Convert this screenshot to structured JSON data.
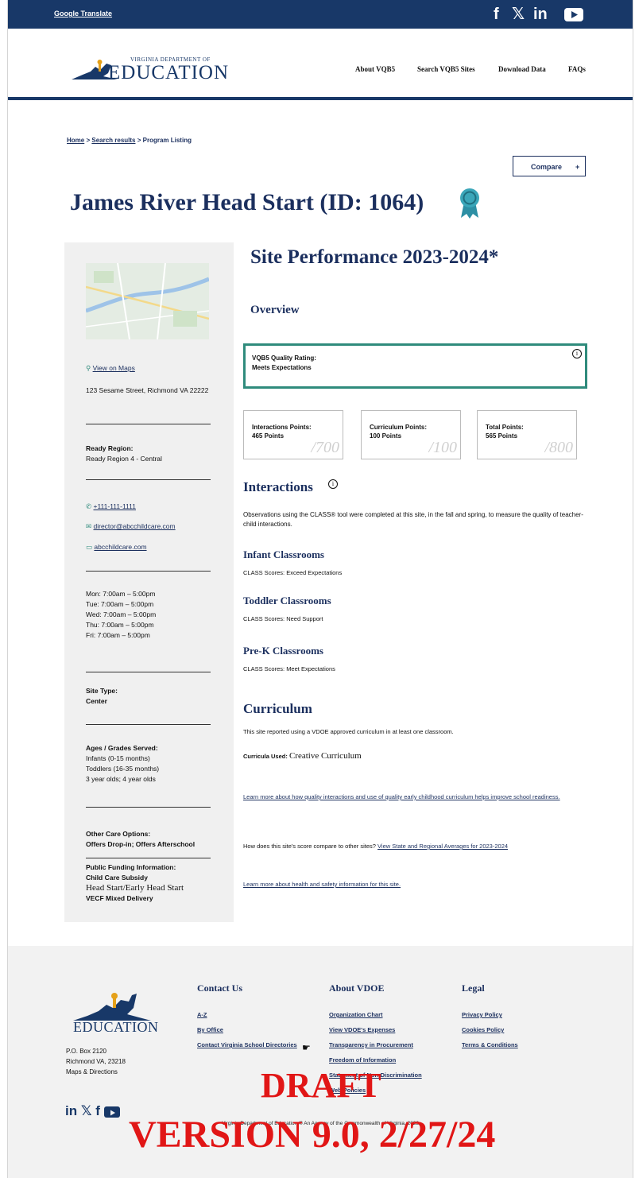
{
  "topbar": {
    "google_translate": "Google Translate",
    "social": [
      "f",
      "𝕏",
      "in",
      "▶"
    ]
  },
  "header": {
    "logo_text": "EDUCATION",
    "logo_subtext": "VIRGINIA DEPARTMENT OF",
    "nav": [
      "About VQB5",
      "Search VQB5 Sites",
      "Download Data",
      "FAQs"
    ]
  },
  "breadcrumb": {
    "home": "Home",
    "sep1": " > ",
    "search": "Search results",
    "sep2": " > ",
    "current": "Program Listing"
  },
  "compare": {
    "label": "Compare",
    "icon": "+"
  },
  "title": "James River Head Start (ID: 1064)",
  "sidebar": {
    "map_link": "View on Maps",
    "address": "123 Sesame Street, Richmond VA 22222",
    "region_label": "Ready Region:",
    "region_value": "Ready Region 4 - Central",
    "phone": "+111-111-1111",
    "email": "director@abcchildcare.com",
    "website": "abcchildcare.com",
    "hours": [
      "Mon: 7:00am – 5:00pm",
      "Tue: 7:00am – 5:00pm",
      "Wed: 7:00am – 5:00pm",
      "Thu: 7:00am – 5:00pm",
      "Fri: 7:00am – 5:00pm"
    ],
    "site_type_label": "Site Type:",
    "site_type_value": "Center",
    "ages_label": "Ages / Grades Served:",
    "ages_values": [
      "Infants (0-15 months)",
      "Toddlers (16-35 months)",
      "3 year olds; 4 year olds"
    ],
    "other_label": "Other Care Options:",
    "other_value": "Offers Drop-in; Offers Afterschool",
    "funding_label": "Public Funding Information:",
    "funding_values": [
      "Child Care Subsidy",
      "Head Start/Early Head Start",
      "VECF Mixed Delivery"
    ]
  },
  "main": {
    "heading": "Site Performance 2023-2024*",
    "overview": "Overview",
    "quality_label": "VQB5 Quality Rating:",
    "quality_value": "Meets Expectations",
    "points": [
      {
        "label": "Interactions Points:",
        "value": "465 Points",
        "max": "/700"
      },
      {
        "label": "Curriculum Points:",
        "value": "100 Points",
        "max": "/100"
      },
      {
        "label": "Total Points:",
        "value": "565 Points",
        "max": "/800"
      }
    ],
    "interactions_heading": "Interactions",
    "interactions_text": "Observations using the CLASS® tool were completed at this site, in the fall and spring, to measure the quality of teacher-child interactions.",
    "classrooms": [
      {
        "heading": "Infant Classrooms",
        "text": "CLASS Scores: Exceed Expectations"
      },
      {
        "heading": "Toddler Classrooms",
        "text": "CLASS Scores: Need Support"
      },
      {
        "heading": "Pre-K Classrooms",
        "text": "CLASS Scores: Meet Expectations"
      }
    ],
    "curriculum_heading": "Curriculum",
    "curriculum_text": "This site reported using a VDOE approved curriculum in at least one classroom.",
    "curricula_label": "Curricula Used:",
    "curricula_value": "Creative Curriculum",
    "learn_more_1": "Learn more about how quality interactions and use of quality early childhood curriculum helps improve school readiness.",
    "compare_question": "How does this site's score compare to other sites?",
    "compare_link": "View State and Regional Averages for 2023-2024",
    "learn_more_2": "Learn more about health and safety information for this site."
  },
  "footer": {
    "logo_text": "EDUCATION",
    "address": [
      "P.O. Box 2120",
      "Richmond VA, 23218",
      "Maps & Directions"
    ],
    "contact_heading": "Contact Us",
    "contact_links": [
      "A-Z",
      "By Office",
      "Contact Virginia School Directories"
    ],
    "about_heading": "About VDOE",
    "about_links": [
      "Organization Chart",
      "View VDOE's Expenses",
      "Transparency in Procurement",
      "Freedom of Information",
      "Statement of Non-Discrimination",
      "Web Policies"
    ],
    "legal_heading": "Legal",
    "legal_links": [
      "Privacy Policy",
      "Cookies Policy",
      "Terms & Conditions"
    ],
    "copyright": "Virginia Department of Education © An Agency of the Commonwealth of Virginia, 2023"
  },
  "watermark": {
    "line1": "DRAFT",
    "line2": "VERSION 9.0, 2/27/24"
  }
}
